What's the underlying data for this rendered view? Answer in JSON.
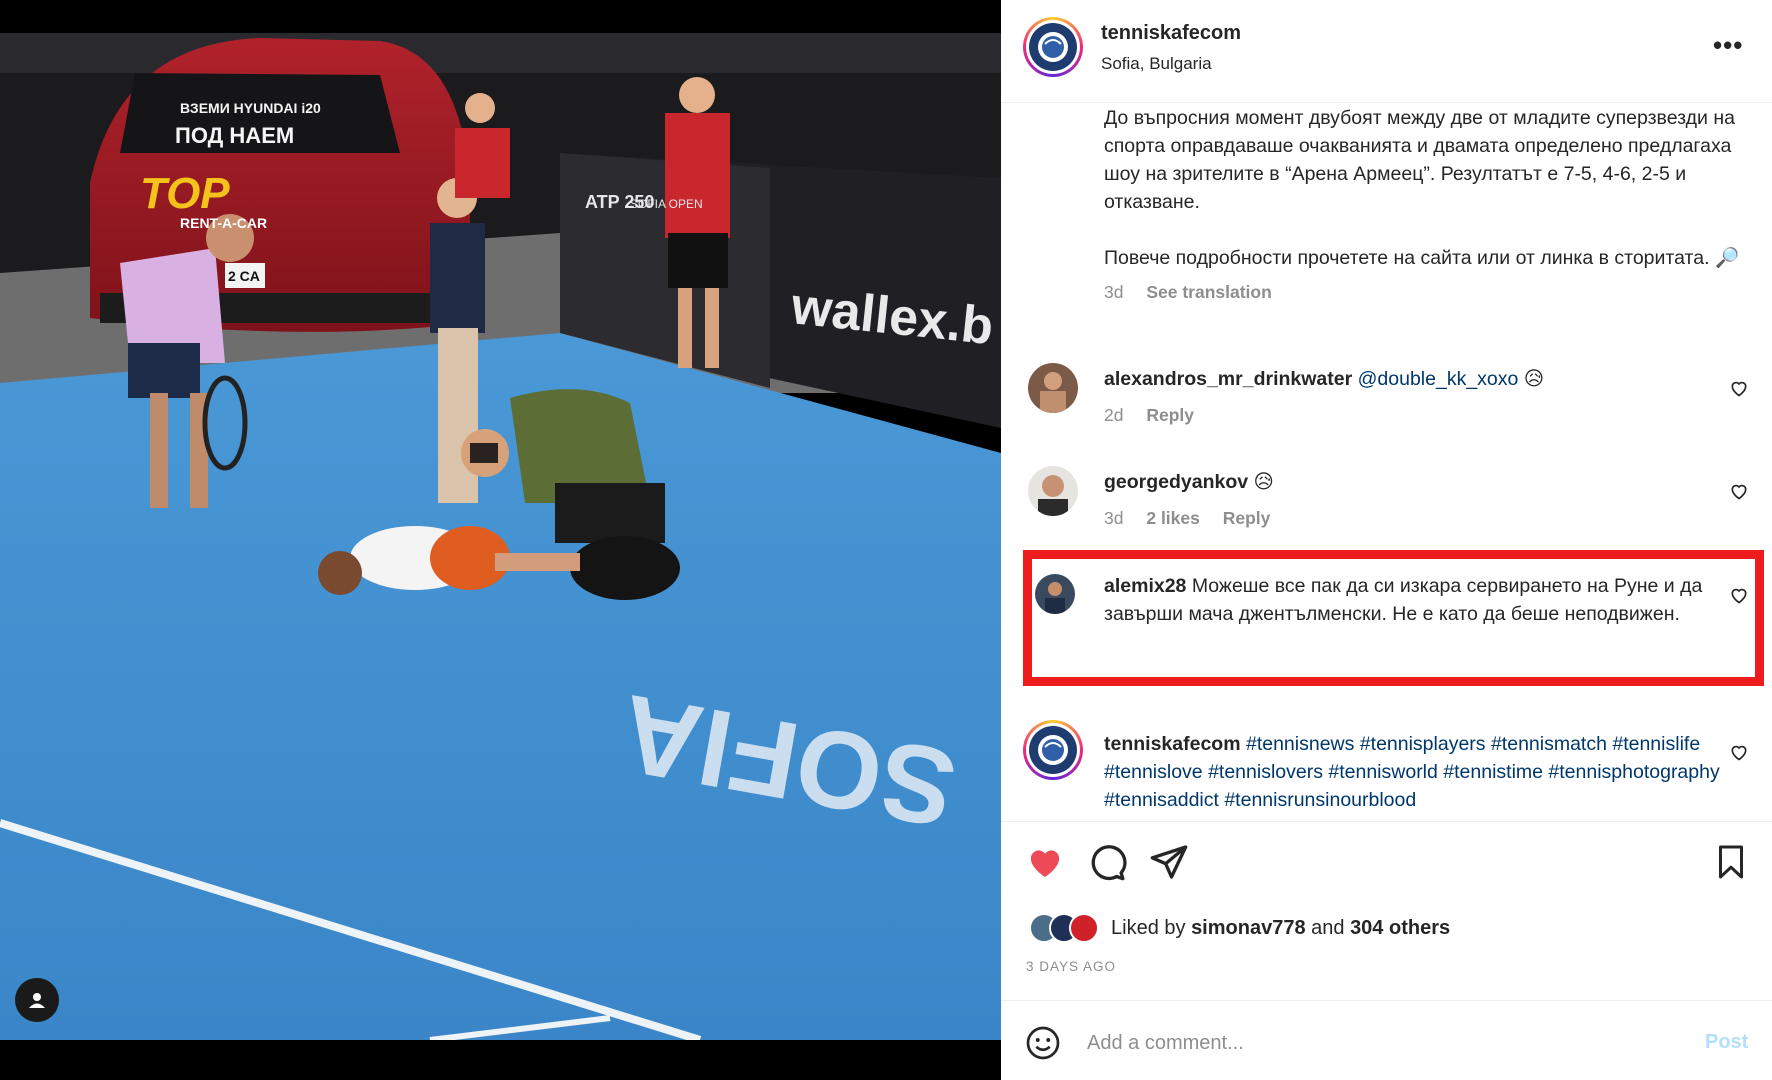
{
  "post": {
    "username": "tenniskafecom",
    "location": "Sofia, Bulgaria",
    "more_label": "•••"
  },
  "caption": {
    "text": "До въпросния момент двубоят между две от младите суперзвезди на спорта оправдаваше очакванията и двамата определено предлагаха шоу на зрителите в “Арена Армеец”. Резултатът е 7-5, 4-6, 2-5 и отказване.",
    "text2": "Повече подробности прочетете на сайта или от линка в сторитата. 🔎",
    "age": "3d",
    "see_translation": "See translation"
  },
  "comments": [
    {
      "username": "alexandros_mr_drinkwater",
      "mention": "@double_kk_xoxo",
      "text": " 😥",
      "age": "2d",
      "reply": "Reply"
    },
    {
      "username": "georgedyankov",
      "text": " 😥",
      "age": "3d",
      "likes": "2 likes",
      "reply": "Reply"
    },
    {
      "username": "alemix28",
      "text": " Можеше все пак да си изкара сервирането на Руне и да завърши мача джентълменски. Не е като да беше неподвижен."
    },
    {
      "username": "tenniskafecom",
      "text": " #tennisnews #tennisplayers #tennismatch #tennislife #tennislove #tennislovers #tennisworld #tennistime #tennisphotography #tennisaddict #tennisrunsinourblood"
    }
  ],
  "photo": {
    "car_banner_line1": "ВЗЕМИ HYUNDAI i20",
    "car_banner_line2": "ПОД НАЕМ",
    "car_brand": "TOP",
    "car_brand_sub": "RENT-A-CAR",
    "plate": "2 CA",
    "atp_label": "ATP 250",
    "sofia_open": "SOFIA OPEN",
    "wallex": "wallex.b",
    "court_text": "SOFIA"
  },
  "likes": {
    "prefix": "Liked by ",
    "user": "simonav778",
    "middle": " and ",
    "others": "304 others"
  },
  "date": "3 DAYS AGO",
  "comment_box": {
    "placeholder": "Add a comment...",
    "post_label": "Post"
  },
  "colors": {
    "like_red": "#ed4956",
    "highlight_red": "#ee1c1c",
    "link_blue": "#00376b",
    "post_blue_disabled": "#b2dffc",
    "court_blue": "#3c8fd0"
  }
}
